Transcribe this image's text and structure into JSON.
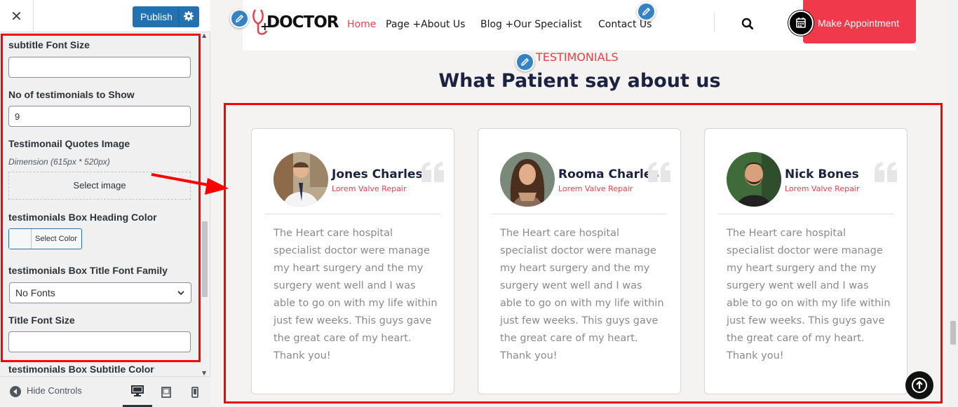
{
  "customizer": {
    "close_icon": "close-icon",
    "publish_label": "Publish",
    "settings_icon": "gear-icon",
    "fields": {
      "subtitle_font_size": {
        "label": "subtitle Font Size",
        "value": ""
      },
      "testimonials_count": {
        "label": "No of testimonials to Show",
        "value": "9"
      },
      "quotes_image": {
        "label": "Testimonail Quotes Image",
        "description": "Dimension (615px * 520px)",
        "button": "Select image"
      },
      "box_heading_color": {
        "label": "testimonials Box Heading Color",
        "button": "Select Color"
      },
      "box_title_font_family": {
        "label": "testimonials Box Title Font Family",
        "selected": "No Fonts"
      },
      "title_font_size": {
        "label": "Title Font Size",
        "value": ""
      },
      "box_subtitle_color": {
        "label": "testimonials Box Subtitle Color"
      }
    },
    "footer": {
      "hide_controls": "Hide Controls",
      "devices": [
        "desktop-icon",
        "tablet-icon",
        "mobile-icon"
      ],
      "active_device": "desktop"
    }
  },
  "site": {
    "logo_text": "DOCTOR",
    "nav": {
      "home": "Home",
      "page": "Page +About Us",
      "blog": "Blog +Our Specialist",
      "contact": "Contact Us"
    },
    "appointment_button": "Make Appointment",
    "accent_color": "#e8414c",
    "heading_color": "#1c2340"
  },
  "testimonials": {
    "subtitle": "TESTIMONIALS",
    "heading": "What Patient say about us",
    "cards": [
      {
        "name": "Jones Charles",
        "role": "Lorem Valve Repair",
        "text": "The Heart care hospital specialist doctor were manage my heart surgery and the my surgery went well and I was able to go on with my life within just few weeks. This guys gave the great care of my heart. Thank you!"
      },
      {
        "name": "Rooma Charles",
        "role": "Lorem Valve Repair",
        "text": "The Heart care hospital specialist doctor were manage my heart surgery and the my surgery went well and I was able to go on with my life within just few weeks. This guys gave the great care of my heart. Thank you!"
      },
      {
        "name": "Nick Bones",
        "role": "Lorem Valve Repair",
        "text": "The Heart care hospital specialist doctor were manage my heart surgery and the my surgery went well and I was able to go on with my life within just few weeks. This guys gave the great care of my heart. Thank you!"
      }
    ]
  }
}
